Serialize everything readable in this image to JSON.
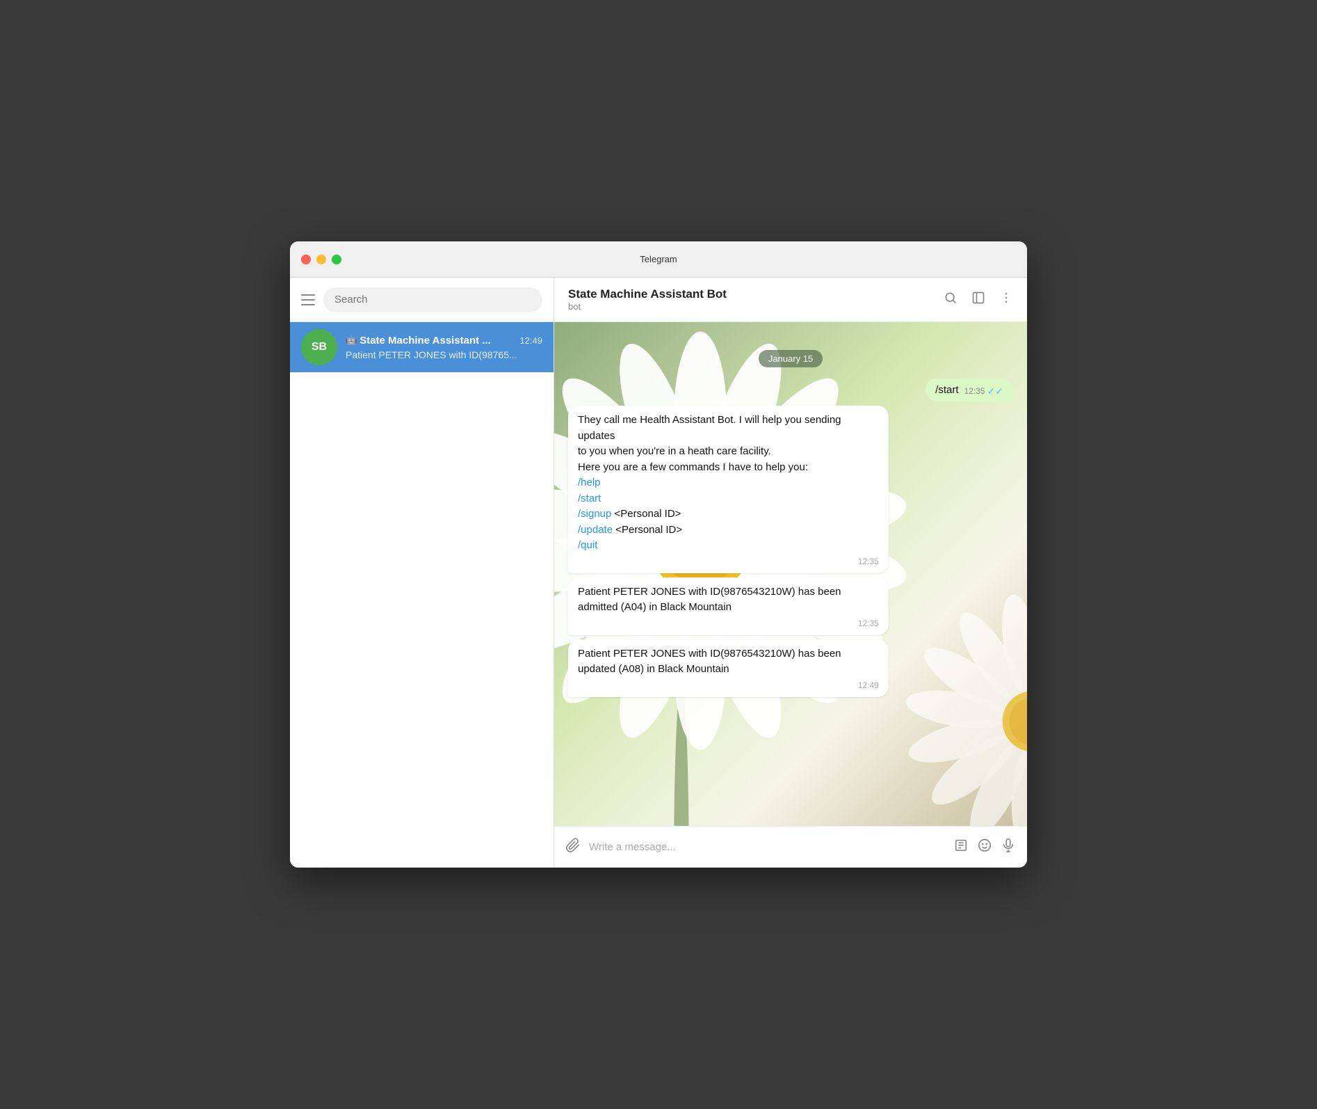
{
  "window": {
    "title": "Telegram"
  },
  "sidebar": {
    "search_placeholder": "Search",
    "chat": {
      "avatar_initials": "SB",
      "avatar_color": "#4caf50",
      "name": "State Machine Assistant ...",
      "time": "12:49",
      "preview": "Patient PETER JONES with ID(98765..."
    }
  },
  "chat_header": {
    "name": "State Machine Assistant Bot",
    "status": "bot",
    "icons": [
      "search",
      "sidebar",
      "more"
    ]
  },
  "messages": {
    "date_badge": "January 15",
    "sent": {
      "text": "/start",
      "time": "12:35",
      "read": true
    },
    "bot_message_1": {
      "lines": [
        "They call me Health Assistant Bot. I will help you sending updates",
        "to you when you're in a heath care facility.",
        "Here you are a few commands I have to help you:",
        "/help",
        "/start",
        "/signup <Personal ID>",
        "/update <Personal ID>",
        "/quit"
      ],
      "time": "12:35",
      "commands": [
        "/help",
        "/start",
        "/signup",
        "/update",
        "/quit"
      ]
    },
    "bot_message_2": {
      "text": "Patient PETER JONES with ID(9876543210W) has been admitted (A04) in Black Mountain",
      "time": "12:35"
    },
    "bot_message_3": {
      "text": "Patient PETER JONES with ID(9876543210W) has been updated (A08) in Black Mountain",
      "time": "12:49"
    }
  },
  "input": {
    "placeholder": "Write a message..."
  }
}
